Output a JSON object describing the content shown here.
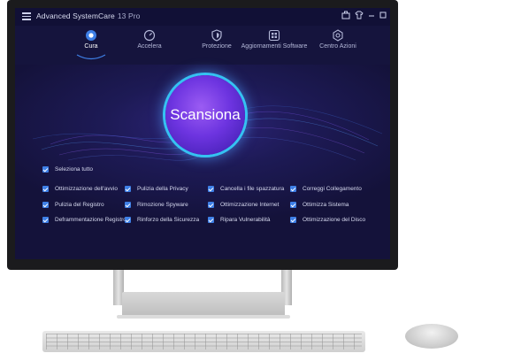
{
  "app": {
    "title": "Advanced SystemCare",
    "version": "13 Pro"
  },
  "window_controls": [
    "toolbox-icon",
    "shirt-icon",
    "minimize-icon",
    "maximize-icon",
    "close-icon"
  ],
  "tabs": [
    {
      "label": "Cura",
      "icon": "care-icon",
      "active": true
    },
    {
      "label": "Accelera",
      "icon": "speedometer-icon",
      "active": false
    },
    {
      "label": "Protezione",
      "icon": "shield-icon",
      "active": false
    },
    {
      "label": "Aggiornamenti Software",
      "icon": "update-grid-icon",
      "active": false
    },
    {
      "label": "Centro Azioni",
      "icon": "gear-icon",
      "active": false
    }
  ],
  "scan": {
    "label": "Scansiona"
  },
  "select_all": {
    "label": "Seleziona tutto",
    "checked": true
  },
  "options": [
    {
      "label": "Ottimizzazione dell'avvio",
      "checked": true
    },
    {
      "label": "Pulizia della Privacy",
      "checked": true
    },
    {
      "label": "Cancella i file spazzatura",
      "checked": true
    },
    {
      "label": "Correggi Collegamento",
      "checked": true
    },
    {
      "label": "Pulizia del Registro",
      "checked": true
    },
    {
      "label": "Rimozione Spyware",
      "checked": true
    },
    {
      "label": "Ottimizzazione Internet",
      "checked": true
    },
    {
      "label": "Ottimizza Sistema",
      "checked": true
    },
    {
      "label": "Deframmentazione Registro",
      "checked": true
    },
    {
      "label": "Rinforzo della Sicurezza",
      "checked": true
    },
    {
      "label": "Ripara Vulnerabilità",
      "checked": true
    },
    {
      "label": "Ottimizzazione del Disco",
      "checked": true
    }
  ],
  "colors": {
    "accent": "#3e7fe6",
    "scan_ring": "#35c2f2",
    "background": "#14123a"
  }
}
